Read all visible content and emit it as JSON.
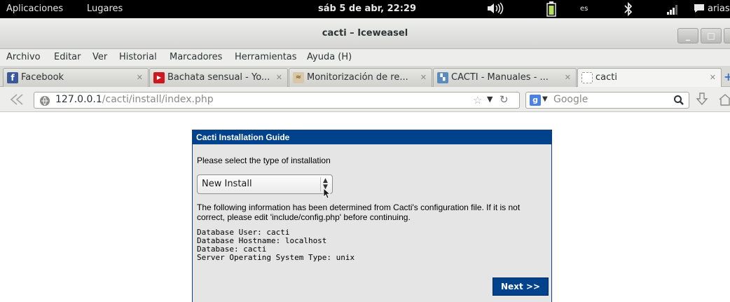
{
  "system_bar": {
    "applications": "Aplicaciones",
    "places": "Lugares",
    "datetime": "sáb  5 de abr, 22:29",
    "keyboard": "es",
    "user": "arias"
  },
  "window": {
    "title": "cacti – Iceweasel"
  },
  "menu": {
    "items": [
      "Archivo",
      "Editar",
      "Ver",
      "Historial",
      "Marcadores",
      "Herramientas",
      "Ayuda (H)"
    ]
  },
  "tabs": [
    {
      "label": "Facebook"
    },
    {
      "label": "Bachata sensual - Yo..."
    },
    {
      "label": "Monitorización de re..."
    },
    {
      "label": "CACTI - Manuales - ..."
    },
    {
      "label": "cacti"
    }
  ],
  "nav": {
    "url_host": "127.0.0.1",
    "url_path": "/cacti/install/index.php",
    "search_placeholder": "Google"
  },
  "install": {
    "header": "Cacti Installation Guide",
    "prompt": "Please select the type of installation",
    "selected_type": "New Install",
    "info_line1": "The following information has been determined from Cacti's configuration file. If it is not",
    "info_line2": "correct, please edit 'include/config.php' before continuing.",
    "db_user": "Database User: cacti",
    "db_host": "Database Hostname: localhost",
    "db_name": "Database: cacti",
    "os_type": "Server Operating System Type: unix",
    "next_label": "Next >>"
  },
  "colors": {
    "panel_header": "#00438c",
    "panel_bg": "#e5e5e5"
  }
}
